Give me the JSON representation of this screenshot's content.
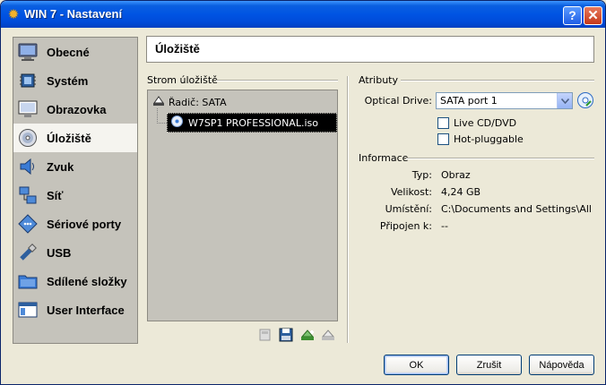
{
  "window": {
    "title": "WIN 7 - Nastavení",
    "help_label": "?",
    "close_label": "✕"
  },
  "sidebar": {
    "items": [
      {
        "label": "Obecné",
        "icon": "monitor-general-icon",
        "active": false
      },
      {
        "label": "Systém",
        "icon": "chip-system-icon",
        "active": false
      },
      {
        "label": "Obrazovka",
        "icon": "display-icon",
        "active": false
      },
      {
        "label": "Úložiště",
        "icon": "disk-storage-icon",
        "active": true
      },
      {
        "label": "Zvuk",
        "icon": "speaker-icon",
        "active": false
      },
      {
        "label": "Síť",
        "icon": "network-icon",
        "active": false
      },
      {
        "label": "Sériové porty",
        "icon": "serial-port-icon",
        "active": false
      },
      {
        "label": "USB",
        "icon": "usb-icon",
        "active": false
      },
      {
        "label": "Sdílené složky",
        "icon": "shared-folder-icon",
        "active": false
      },
      {
        "label": "User Interface",
        "icon": "user-interface-icon",
        "active": false
      }
    ]
  },
  "page_title": "Úložiště",
  "storage_tree": {
    "header": "Strom úložiště",
    "controller": {
      "label": "Řadič: SATA",
      "icon": "controller-icon"
    },
    "attachment": {
      "label": "W7SP1 PROFESSIONAL.iso",
      "icon": "optical-disc-icon",
      "selected": true
    }
  },
  "toolbar": {
    "buttons": [
      {
        "name": "add-controller-button",
        "icon": "add-controller-icon",
        "enabled": false
      },
      {
        "name": "add-disk-button",
        "icon": "floppy-icon",
        "enabled": true
      },
      {
        "name": "add-attachment-button",
        "icon": "add-attachment-icon",
        "enabled": true
      },
      {
        "name": "remove-attachment-button",
        "icon": "remove-attachment-icon",
        "enabled": true
      }
    ]
  },
  "attributes": {
    "header": "Atributy",
    "optical_drive_label": "Optical Drive:",
    "optical_drive_value": "SATA port 1",
    "live_cd_label": "Live CD/DVD",
    "live_cd_checked": false,
    "hot_plug_label": "Hot-pluggable",
    "hot_plug_checked": false
  },
  "information": {
    "header": "Informace",
    "rows": [
      {
        "label": "Typ:",
        "value": "Obraz"
      },
      {
        "label": "Velikost:",
        "value": "4,24 GB"
      },
      {
        "label": "Umístění:",
        "value": "C:\\Documents and Settings\\All Us..."
      },
      {
        "label": "Připojen k:",
        "value": "--"
      }
    ]
  },
  "buttons": {
    "ok": "OK",
    "cancel": "Zrušit",
    "help": "Nápověda"
  },
  "colors": {
    "titlebar": "#0054e3",
    "selection": "#000000",
    "window_bg": "#ece9d8",
    "sidebar_bg": "#c5c3bb"
  }
}
